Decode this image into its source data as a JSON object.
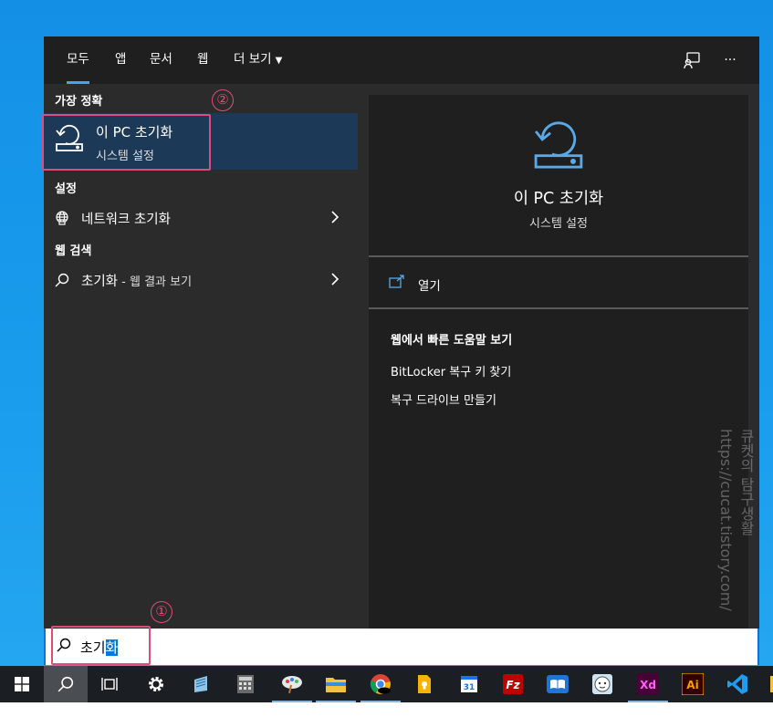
{
  "tabs": [
    {
      "label": "모두",
      "active": true
    },
    {
      "label": "앱"
    },
    {
      "label": "문서"
    },
    {
      "label": "웹"
    },
    {
      "label": "더 보기"
    }
  ],
  "top_icons": [
    "feedback-icon",
    "more-icon"
  ],
  "more_label": "···",
  "best_match": {
    "header": "가장 정확",
    "title": "이 PC 초기화",
    "subtitle": "시스템 설정"
  },
  "settings": {
    "header": "설정",
    "items": [
      {
        "label": "네트워크 초기화",
        "icon": "network-globe-icon"
      }
    ]
  },
  "web_search": {
    "header": "웹 검색",
    "items": [
      {
        "label": "초기화",
        "suffix": " - 웹 결과 보기",
        "icon": "search-icon"
      }
    ]
  },
  "detail": {
    "title": "이 PC 초기화",
    "subtitle": "시스템 설정",
    "open_label": "열기",
    "help_title": "웹에서 빠른 도움말 보기",
    "help_links": [
      "BitLocker 복구 키 찾기",
      "복구 드라이브 만들기"
    ]
  },
  "annotations": {
    "one": "①",
    "two": "②"
  },
  "watermark": {
    "line1": "큐켓의 탐구생활",
    "line2": "https://cucat.tistory.com/"
  },
  "search": {
    "typed": "초기",
    "selected": "화"
  },
  "taskbar": {
    "items": [
      "windows-start-icon",
      "search-icon",
      "task-view-icon",
      "settings-gear-icon",
      "notepad-icon",
      "calculator-icon",
      "paint-icon",
      "file-explorer-icon",
      "chrome-icon",
      "keep-icon",
      "calendar-icon",
      "filezilla-icon",
      "reader-icon",
      "messenger-icon",
      "adobe-xd-icon",
      "adobe-illustrator-icon",
      "vscode-icon",
      "folder-icon"
    ],
    "labels": {
      "calendar": "31",
      "filezilla": "Fz",
      "xd": "Xd",
      "ai": "Ai"
    }
  },
  "colors": {
    "accent": "#4ea1e6",
    "highlight": "#1c3a57",
    "annotation": "#e04b7a",
    "taskbar": "#1b1e22"
  }
}
